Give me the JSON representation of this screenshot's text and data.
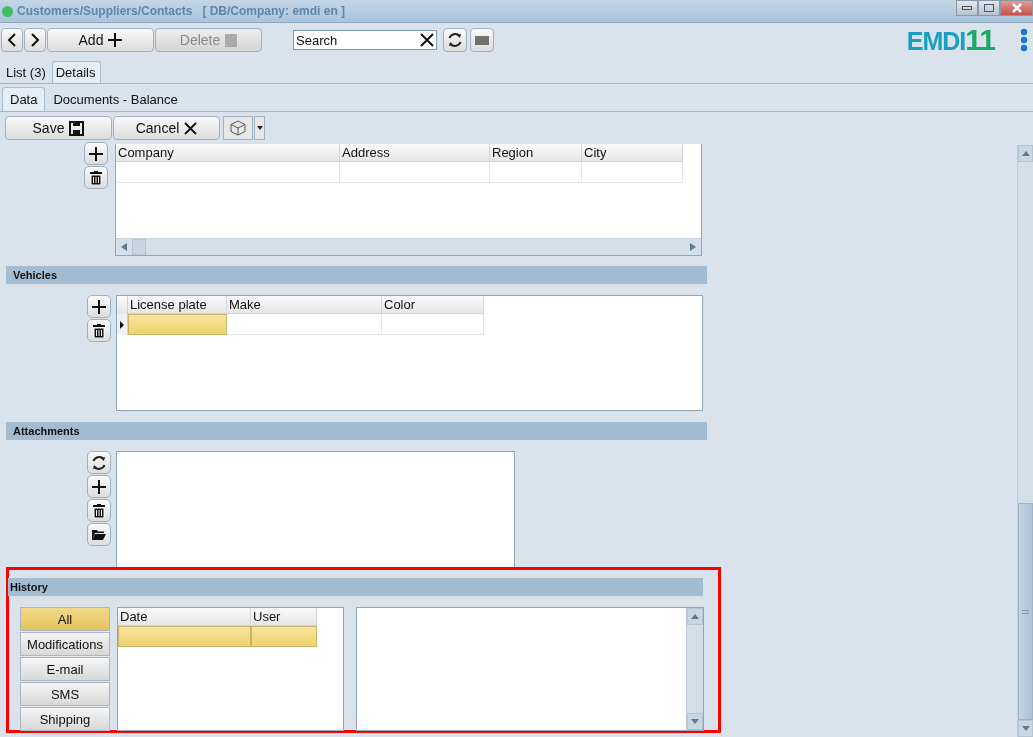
{
  "window": {
    "title": "Customers/Suppliers/Contacts",
    "subtitle": "[ DB/Company: emdi en ]"
  },
  "toolbar": {
    "add": "Add",
    "delete": {
      "label": "Delete",
      "disabled": true
    },
    "search": {
      "placeholder": "Search"
    }
  },
  "logo": {
    "letters": "EMDI",
    "number": "11"
  },
  "tabs": [
    {
      "label": "List (3)",
      "selected": false
    },
    {
      "label": "Details",
      "selected": true
    }
  ],
  "subtabs": [
    {
      "label": "Data",
      "selected": true
    },
    {
      "label": "Documents - Balance",
      "selected": false
    }
  ],
  "actions": {
    "save": "Save",
    "cancel": "Cancel"
  },
  "companies": {
    "columns": [
      "Company",
      "Address",
      "Region",
      "City"
    ],
    "rows": [
      {
        "selected": false
      }
    ]
  },
  "vehicles": {
    "title": "Vehicles",
    "columns": [
      "License plate",
      "Make",
      "Color"
    ],
    "rows": [
      {
        "selected": true
      }
    ]
  },
  "attachments": {
    "title": "Attachments"
  },
  "history": {
    "title": "History",
    "highlighted": true,
    "filters": [
      {
        "label": "All",
        "selected": true
      },
      {
        "label": "Modifications",
        "selected": false
      },
      {
        "label": "E-mail",
        "selected": false
      },
      {
        "label": "SMS",
        "selected": false
      },
      {
        "label": "Shipping",
        "selected": false
      }
    ],
    "columns": [
      "Date",
      "User"
    ],
    "rows": [
      {
        "selected": true
      }
    ]
  }
}
